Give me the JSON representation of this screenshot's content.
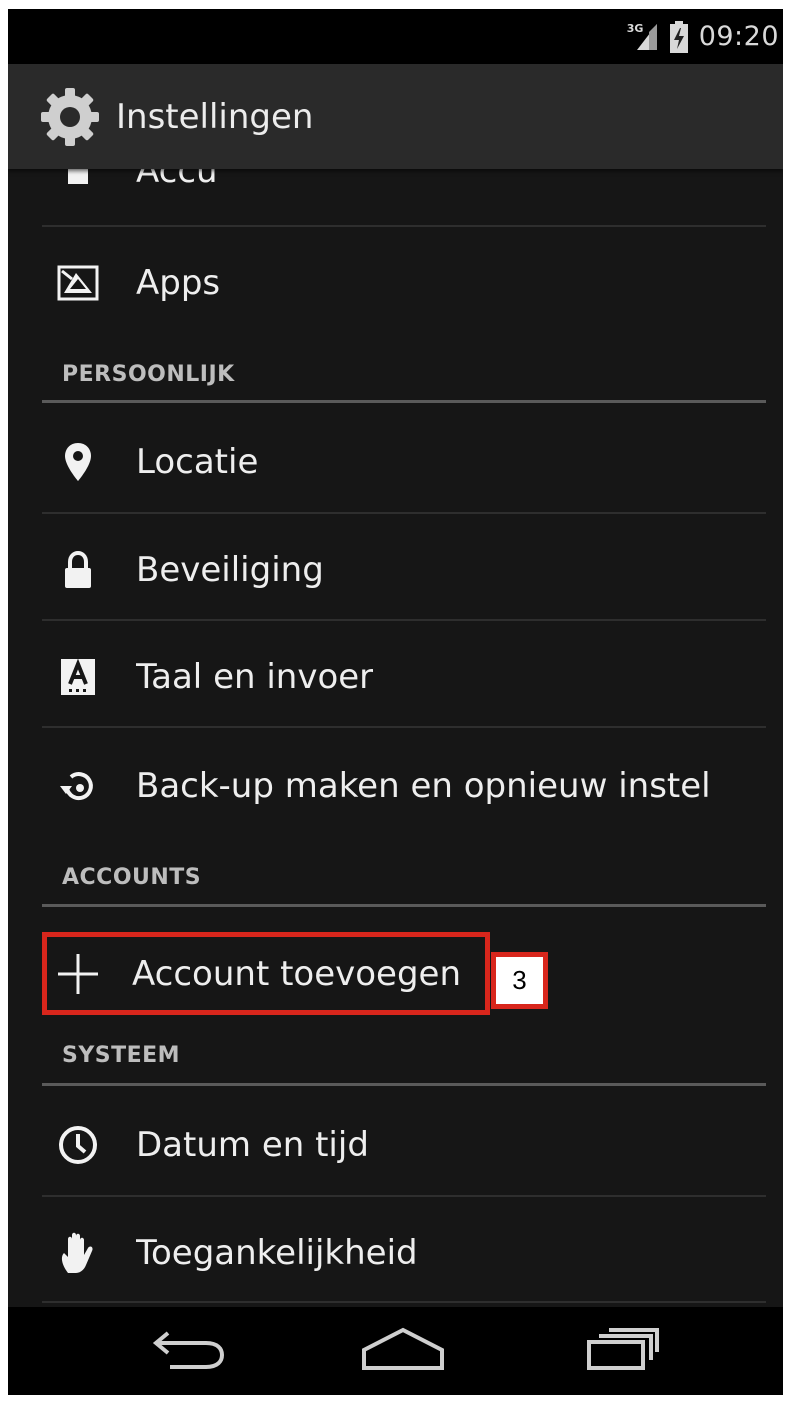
{
  "status_bar": {
    "network": "3G",
    "time": "09:20"
  },
  "action_bar": {
    "title": "Instellingen",
    "icon": "settings-gear-icon"
  },
  "items": {
    "accu": {
      "label": "Accu",
      "icon": "battery-icon"
    },
    "apps": {
      "label": "Apps",
      "icon": "apps-icon"
    },
    "locatie": {
      "label": "Locatie",
      "icon": "location-pin-icon"
    },
    "beveiliging": {
      "label": "Beveiliging",
      "icon": "lock-icon"
    },
    "taal": {
      "label": "Taal en invoer",
      "icon": "keyboard-a-icon"
    },
    "backup": {
      "label": "Back-up maken en opnieuw instel",
      "icon": "backup-restore-icon"
    },
    "account_toevoegen": {
      "label": "Account toevoegen",
      "icon": "plus-icon"
    },
    "datum": {
      "label": "Datum en tijd",
      "icon": "clock-icon"
    },
    "toegankelijkheid": {
      "label": "Toegankelijkheid",
      "icon": "hand-icon"
    }
  },
  "sections": {
    "persoonlijk": "PERSOONLIJK",
    "accounts": "ACCOUNTS",
    "systeem": "SYSTEEM"
  },
  "annotation": {
    "badge": "3",
    "color": "#d8261c"
  },
  "nav_bar": {
    "back": "back-icon",
    "home": "home-icon",
    "recents": "recent-apps-icon"
  }
}
